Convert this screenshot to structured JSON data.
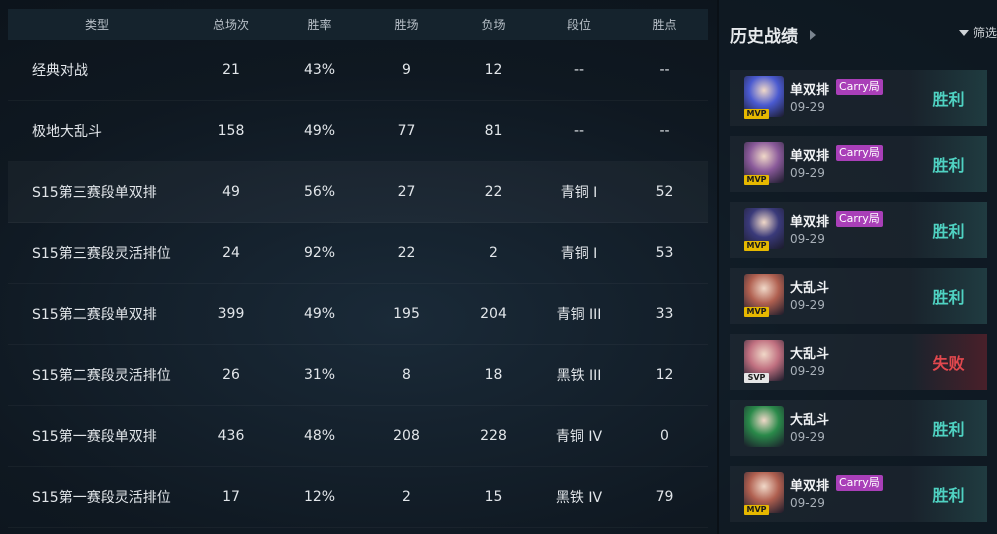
{
  "table": {
    "headers": [
      "类型",
      "总场次",
      "胜率",
      "胜场",
      "负场",
      "段位",
      "胜点"
    ],
    "rows": [
      [
        "经典对战",
        "21",
        "43%",
        "9",
        "12",
        "--",
        "--"
      ],
      [
        "极地大乱斗",
        "158",
        "49%",
        "77",
        "81",
        "--",
        "--"
      ],
      [
        "S15第三赛段单双排",
        "49",
        "56%",
        "27",
        "22",
        "青铜 I",
        "52"
      ],
      [
        "S15第三赛段灵活排位",
        "24",
        "92%",
        "22",
        "2",
        "青铜 I",
        "53"
      ],
      [
        "S15第二赛段单双排",
        "399",
        "49%",
        "195",
        "204",
        "青铜 III",
        "33"
      ],
      [
        "S15第二赛段灵活排位",
        "26",
        "31%",
        "8",
        "18",
        "黑铁 III",
        "12"
      ],
      [
        "S15第一赛段单双排",
        "436",
        "48%",
        "208",
        "228",
        "青铜 IV",
        "0"
      ],
      [
        "S15第一赛段灵活排位",
        "17",
        "12%",
        "2",
        "15",
        "黑铁 IV",
        "79"
      ]
    ]
  },
  "history": {
    "title": "历史战绩",
    "filter_label": "筛选",
    "matches": [
      {
        "mode": "单双排",
        "tag": "Carry局",
        "date": "09-29",
        "badge": "MVP",
        "result": "胜利",
        "outcome": "win",
        "avatar_color": "#4a5ad0"
      },
      {
        "mode": "单双排",
        "tag": "Carry局",
        "date": "09-29",
        "badge": "MVP",
        "result": "胜利",
        "outcome": "win",
        "avatar_color": "#8a5a9a"
      },
      {
        "mode": "单双排",
        "tag": "Carry局",
        "date": "09-29",
        "badge": "MVP",
        "result": "胜利",
        "outcome": "win",
        "avatar_color": "#3a3a7a"
      },
      {
        "mode": "大乱斗",
        "tag": "",
        "date": "09-29",
        "badge": "MVP",
        "result": "胜利",
        "outcome": "win",
        "avatar_color": "#b06050"
      },
      {
        "mode": "大乱斗",
        "tag": "",
        "date": "09-29",
        "badge": "SVP",
        "result": "失败",
        "outcome": "lose",
        "avatar_color": "#c07080"
      },
      {
        "mode": "大乱斗",
        "tag": "",
        "date": "09-29",
        "badge": "",
        "result": "胜利",
        "outcome": "win",
        "avatar_color": "#2a8a4a"
      },
      {
        "mode": "单双排",
        "tag": "Carry局",
        "date": "09-29",
        "badge": "MVP",
        "result": "胜利",
        "outcome": "win",
        "avatar_color": "#b06050"
      }
    ]
  }
}
